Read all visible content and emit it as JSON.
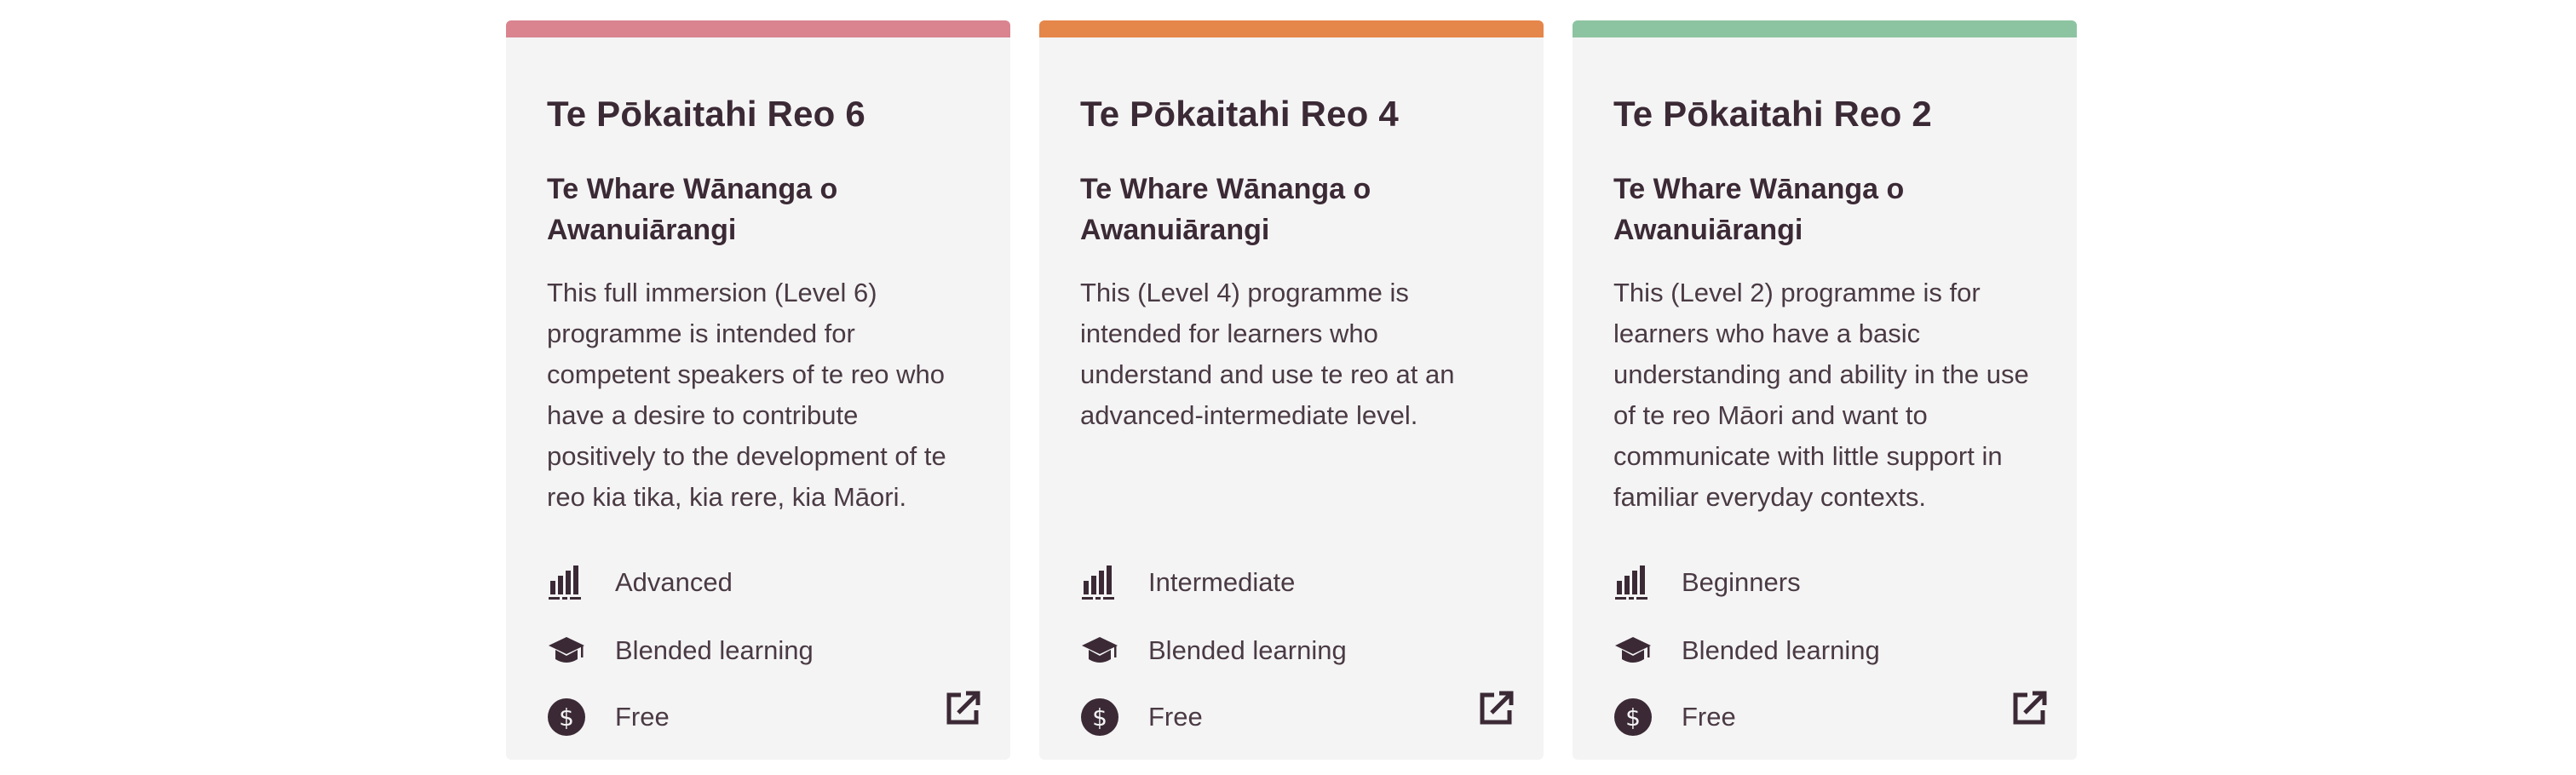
{
  "colors": {
    "text": "#3b2a35",
    "card_background": "#f4f4f4",
    "accent_pink": "#d9848f",
    "accent_orange": "#e5864a",
    "accent_green": "#8cc4a1"
  },
  "icons": {
    "level": "level-bars-icon",
    "mode": "graduation-cap-icon",
    "cost": "dollar-circle-icon",
    "link": "external-link-icon"
  },
  "cards": [
    {
      "accent": "#d9848f",
      "title": "Te Pōkaitahi Reo 6",
      "provider": "Te Whare Wānanga o Awanuiārangi",
      "description": "This full immersion (Level 6) programme is intended for competent speakers of te reo who have a desire to contribute positively to the development of te reo kia tika, kia rere, kia Māori.",
      "level": "Advanced",
      "mode": "Blended learning",
      "cost": "Free"
    },
    {
      "accent": "#e5864a",
      "title": "Te Pōkaitahi Reo 4",
      "provider": "Te Whare Wānanga o Awanuiārangi",
      "description": "This (Level 4) programme is intended for learners who understand and use te reo at an advanced-intermediate level.",
      "level": "Intermediate",
      "mode": "Blended learning",
      "cost": "Free"
    },
    {
      "accent": "#8cc4a1",
      "title": "Te Pōkaitahi Reo 2",
      "provider": "Te Whare Wānanga o Awanuiārangi",
      "description": "This (Level 2) programme is for learners who have a basic understanding and ability in the use of te reo Māori and want to communicate with little support in familiar everyday contexts.",
      "level": "Beginners",
      "mode": "Blended learning",
      "cost": "Free"
    }
  ]
}
